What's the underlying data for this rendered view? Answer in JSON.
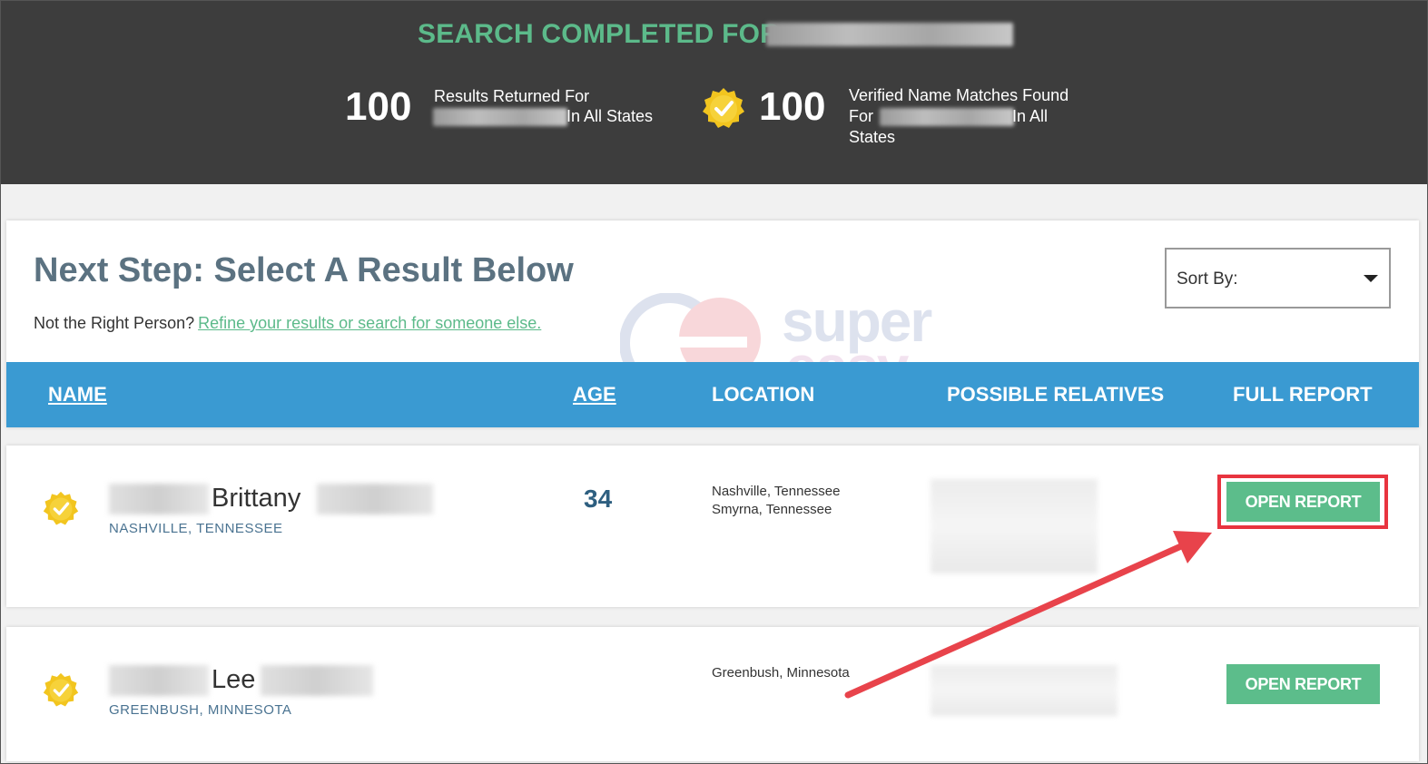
{
  "header": {
    "title": "SEARCH COMPLETED FOR:",
    "stat1": {
      "number": "100",
      "line1": "Results Returned For",
      "tail": "In All States"
    },
    "stat2": {
      "number": "100",
      "line1": "Verified Name Matches Found",
      "for": "For",
      "tail": "In All",
      "line3": "States"
    }
  },
  "main": {
    "heading": "Next Step: Select A Result Below",
    "not_right": "Not the Right Person?",
    "refine_link": "Refine your results or search for someone else.",
    "sort_label": "Sort By:",
    "watermark_line1": "super",
    "watermark_line2": "easy"
  },
  "table": {
    "headers": {
      "name": "NAME",
      "age": "AGE",
      "location": "LOCATION",
      "relatives": "POSSIBLE RELATIVES",
      "report": "FULL REPORT"
    },
    "rows": [
      {
        "name": "Brittany",
        "home": "NASHVILLE, TENNESSEE",
        "age": "34",
        "location1": "Nashville, Tennessee",
        "location2": "Smyrna, Tennessee",
        "button": "OPEN REPORT"
      },
      {
        "name": "Lee",
        "home": "GREENBUSH, MINNESOTA",
        "age": "",
        "location1": "Greenbush, Minnesota",
        "location2": "",
        "button": "OPEN REPORT"
      }
    ]
  },
  "colors": {
    "accent_green": "#5cbd8b",
    "header_blue": "#3a9ad2",
    "highlight_red": "#e8343f"
  }
}
